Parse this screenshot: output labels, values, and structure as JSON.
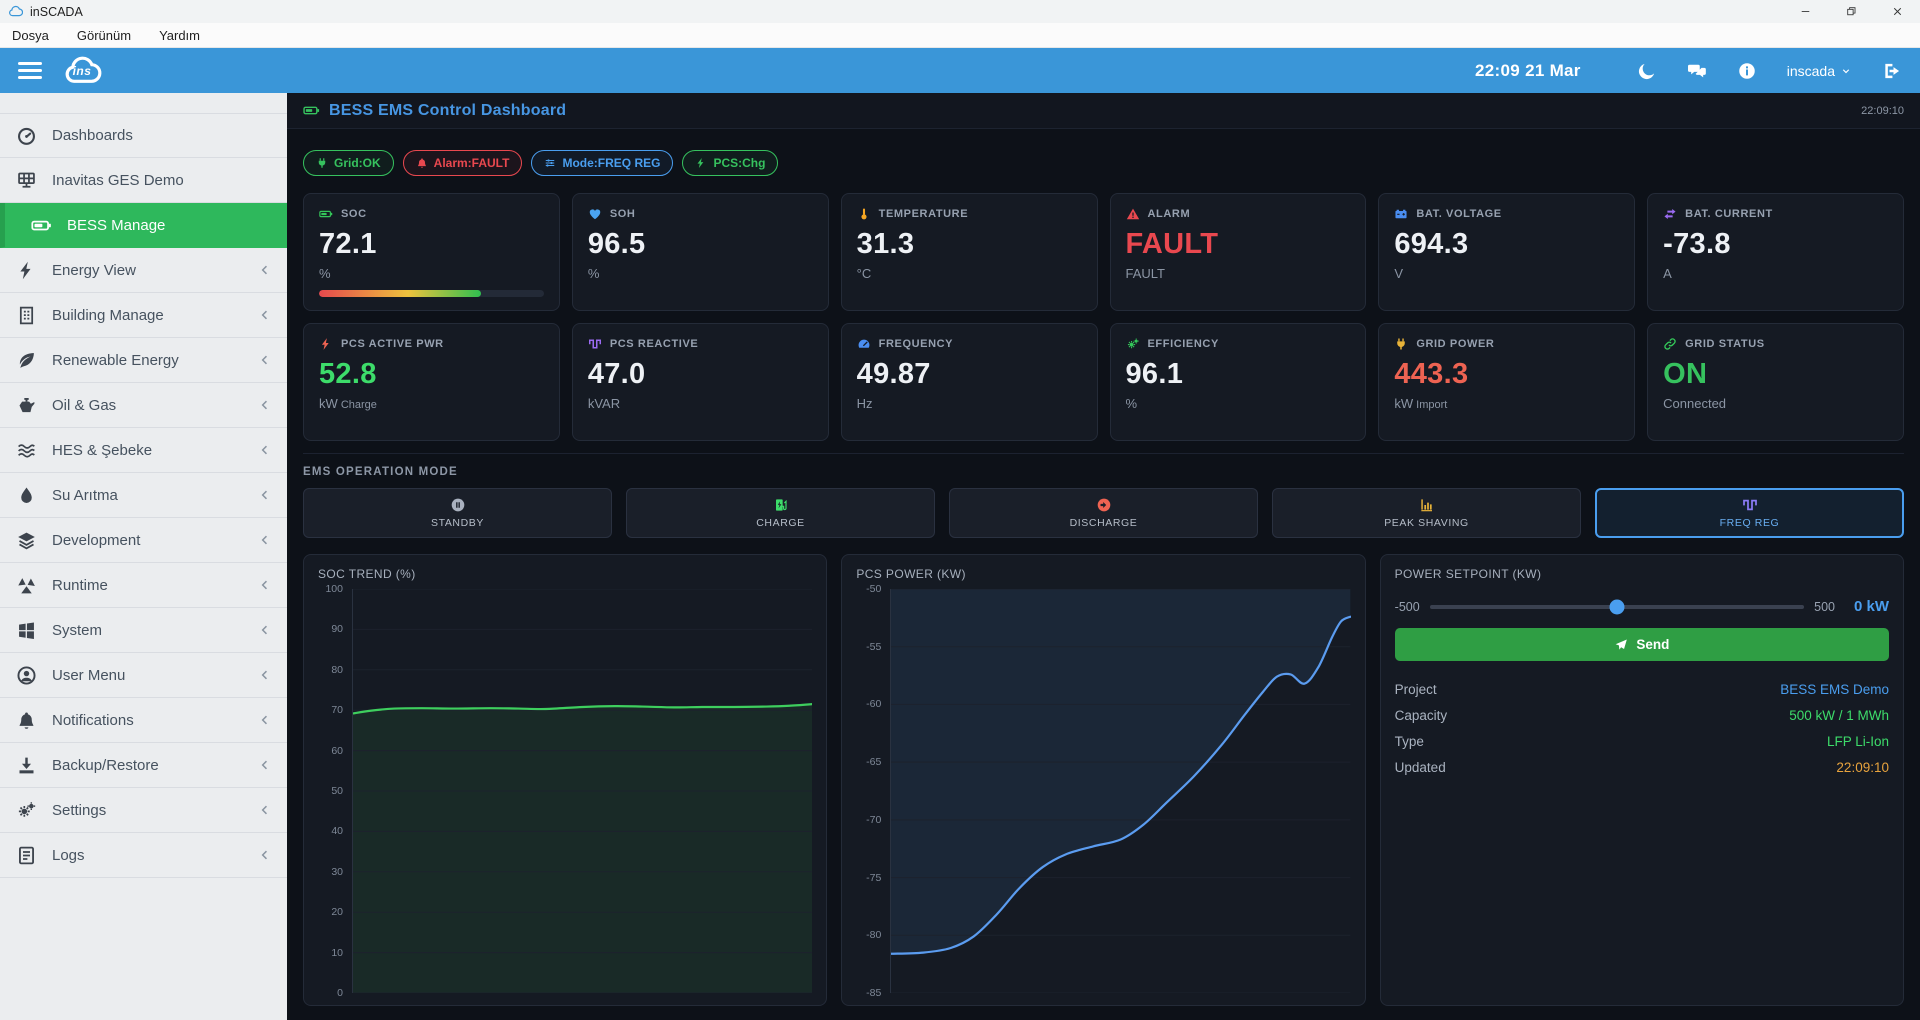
{
  "window": {
    "title": "inSCADA",
    "controls": [
      "minimize-icon",
      "restore-icon",
      "close-icon"
    ]
  },
  "menubar": {
    "items": [
      "Dosya",
      "Görünüm",
      "Yardım"
    ]
  },
  "appbar": {
    "logo": "ins",
    "time": "22:09",
    "date": "21 Mar",
    "icons": [
      "moon",
      "chat",
      "info",
      "sign-out"
    ],
    "user": "inscada"
  },
  "sidebar": {
    "items": [
      {
        "label": "Dashboards",
        "icon": "gauge",
        "chevron": false,
        "active": false
      },
      {
        "label": "Inavitas GES Demo",
        "icon": "solar",
        "chevron": false,
        "active": false
      },
      {
        "label": "BESS Manage",
        "icon": "battery",
        "chevron": false,
        "active": true
      },
      {
        "label": "Energy View",
        "icon": "bolt",
        "chevron": true,
        "active": false
      },
      {
        "label": "Building Manage",
        "icon": "building",
        "chevron": true,
        "active": false
      },
      {
        "label": "Renewable Energy",
        "icon": "leaf",
        "chevron": true,
        "active": false
      },
      {
        "label": "Oil & Gas",
        "icon": "oilcan",
        "chevron": true,
        "active": false
      },
      {
        "label": "HES & Şebeke",
        "icon": "waves",
        "chevron": true,
        "active": false
      },
      {
        "label": "Su Arıtma",
        "icon": "droplet",
        "chevron": true,
        "active": false
      },
      {
        "label": "Development",
        "icon": "layers",
        "chevron": true,
        "active": false
      },
      {
        "label": "Runtime",
        "icon": "pinwheel",
        "chevron": true,
        "active": false
      },
      {
        "label": "System",
        "icon": "windows",
        "chevron": true,
        "active": false
      },
      {
        "label": "User Menu",
        "icon": "user",
        "chevron": true,
        "active": false
      },
      {
        "label": "Notifications",
        "icon": "bell",
        "chevron": true,
        "active": false
      },
      {
        "label": "Backup/Restore",
        "icon": "download",
        "chevron": true,
        "active": false
      },
      {
        "label": "Settings",
        "icon": "gears",
        "chevron": true,
        "active": false
      },
      {
        "label": "Logs",
        "icon": "logs",
        "chevron": true,
        "active": false
      }
    ]
  },
  "dashboard": {
    "title": "BESS EMS Control Dashboard",
    "clock": "22:09:10",
    "badges": [
      {
        "icon": "plug",
        "label": "Grid:OK",
        "color": "#36c25e"
      },
      {
        "icon": "bell",
        "label": "Alarm:FAULT",
        "color": "#e9484f"
      },
      {
        "icon": "sliders",
        "label": "Mode:FREQ REG",
        "color": "#4a9eef"
      },
      {
        "icon": "bolt",
        "label": "PCS:Chg",
        "color": "#36c25e"
      }
    ],
    "kpis": [
      {
        "icon": "battery",
        "icon_color": "#34c759",
        "label": "SOC",
        "value": "72.1",
        "unit": "%",
        "progress": 72.1
      },
      {
        "icon": "heart",
        "icon_color": "#4aa3f0",
        "label": "SOH",
        "value": "96.5",
        "unit": "%"
      },
      {
        "icon": "thermometer",
        "icon_color": "#f5a623",
        "label": "TEMPERATURE",
        "value": "31.3",
        "unit": "°C"
      },
      {
        "icon": "warning",
        "icon_color": "#e9484f",
        "label": "ALARM",
        "value": "FAULT",
        "value_color": "#e9484f",
        "unit": "FAULT"
      },
      {
        "icon": "carbattery",
        "icon_color": "#4a8df0",
        "label": "BAT. VOLTAGE",
        "value": "694.3",
        "unit": "V"
      },
      {
        "icon": "exchange",
        "icon_color": "#9b6bf2",
        "label": "BAT. CURRENT",
        "value": "-73.8",
        "unit": "A"
      },
      {
        "icon": "bolt",
        "icon_color": "#ee6352",
        "label": "PCS ACTIVE PWR",
        "value": "52.8",
        "value_color": "#3ddc6a",
        "unit": "kW",
        "unit_sub": "Charge"
      },
      {
        "icon": "wave",
        "icon_color": "#9b6bf2",
        "label": "PCS REACTIVE",
        "value": "47.0",
        "unit": "kVAR"
      },
      {
        "icon": "gauge2",
        "icon_color": "#4a8df0",
        "label": "FREQUENCY",
        "value": "49.87",
        "unit": "Hz"
      },
      {
        "icon": "gears",
        "icon_color": "#34c759",
        "label": "EFFICIENCY",
        "value": "96.1",
        "unit": "%"
      },
      {
        "icon": "plug",
        "icon_color": "#e8b339",
        "label": "GRID POWER",
        "value": "443.3",
        "value_color": "#ee6352",
        "unit": "kW",
        "unit_sub": "Import"
      },
      {
        "icon": "link",
        "icon_color": "#34c759",
        "label": "GRID STATUS",
        "value": "ON",
        "value_color": "#36c25e",
        "unit": "Connected"
      }
    ],
    "ems": {
      "label": "EMS OPERATION MODE",
      "modes": [
        {
          "label": "STANDBY",
          "icon": "pause",
          "icon_color": "#a9b1bf",
          "active": false
        },
        {
          "label": "CHARGE",
          "icon": "charging",
          "icon_color": "#3ddc6a",
          "active": false
        },
        {
          "label": "DISCHARGE",
          "icon": "arrowright",
          "icon_color": "#ee6352",
          "active": false
        },
        {
          "label": "PEAK SHAVING",
          "icon": "chartbar",
          "icon_color": "#e8b339",
          "active": false
        },
        {
          "label": "FREQ REG",
          "icon": "wave",
          "icon_color": "#8b7bf5",
          "active": true
        }
      ]
    },
    "setpoint": {
      "title": "POWER SETPOINT (KW)",
      "min": "-500",
      "max": "500",
      "value": "0 kW",
      "position": 0.5,
      "send_label": "Send",
      "info": [
        {
          "label": "Project",
          "value": "BESS EMS Demo",
          "color": "#4a9eef"
        },
        {
          "label": "Capacity",
          "value": "500 kW / 1 MWh",
          "color": "#3ddc6a"
        },
        {
          "label": "Type",
          "value": "LFP Li-Ion",
          "color": "#3ddc6a"
        },
        {
          "label": "Updated",
          "value": "22:09:10",
          "color": "#e8a33d"
        }
      ]
    }
  },
  "chart_data": [
    {
      "type": "area",
      "title": "SOC TREND (%)",
      "ylabel": "%",
      "ylim": [
        0,
        100
      ],
      "yticks": [
        100,
        90,
        80,
        70,
        60,
        50,
        40,
        30,
        20,
        10,
        0
      ],
      "grid": true,
      "legend": false,
      "line_color": "#3ecf5e",
      "fill": "rgba(62,207,94,0.09)",
      "fill_to": "bottom",
      "series": [
        {
          "name": "SOC %",
          "points": [
            [
              0,
              69.2
            ],
            [
              0.04,
              69.9
            ],
            [
              0.09,
              70.4
            ],
            [
              0.15,
              70.5
            ],
            [
              0.22,
              70.4
            ],
            [
              0.3,
              70.5
            ],
            [
              0.36,
              70.4
            ],
            [
              0.42,
              70.3
            ],
            [
              0.5,
              70.8
            ],
            [
              0.57,
              71.0
            ],
            [
              0.63,
              70.9
            ],
            [
              0.7,
              70.7
            ],
            [
              0.76,
              70.8
            ],
            [
              0.83,
              70.8
            ],
            [
              0.9,
              70.9
            ],
            [
              0.95,
              71.1
            ],
            [
              1,
              71.5
            ]
          ]
        }
      ]
    },
    {
      "type": "area",
      "title": "PCS POWER (KW)",
      "ylabel": "kW",
      "ylim": [
        -85,
        -50
      ],
      "yticks": [
        -50,
        -55,
        -60,
        -65,
        -70,
        -75,
        -80,
        -85
      ],
      "grid": true,
      "legend": false,
      "line_color": "#5b9cf0",
      "fill": "rgba(91,156,240,0.10)",
      "fill_to": "top",
      "series": [
        {
          "name": "PCS kW",
          "points": [
            [
              0,
              -81.6
            ],
            [
              0.07,
              -81.5
            ],
            [
              0.13,
              -81.1
            ],
            [
              0.18,
              -80.1
            ],
            [
              0.23,
              -78.2
            ],
            [
              0.28,
              -75.9
            ],
            [
              0.33,
              -74.1
            ],
            [
              0.38,
              -73.0
            ],
            [
              0.44,
              -72.3
            ],
            [
              0.5,
              -71.7
            ],
            [
              0.55,
              -70.4
            ],
            [
              0.6,
              -68.5
            ],
            [
              0.66,
              -66.2
            ],
            [
              0.72,
              -63.5
            ],
            [
              0.77,
              -60.9
            ],
            [
              0.81,
              -58.9
            ],
            [
              0.84,
              -57.6
            ],
            [
              0.87,
              -57.4
            ],
            [
              0.9,
              -58.2
            ],
            [
              0.93,
              -56.8
            ],
            [
              0.96,
              -54.2
            ],
            [
              0.98,
              -52.8
            ],
            [
              1,
              -52.4
            ]
          ]
        }
      ]
    }
  ]
}
